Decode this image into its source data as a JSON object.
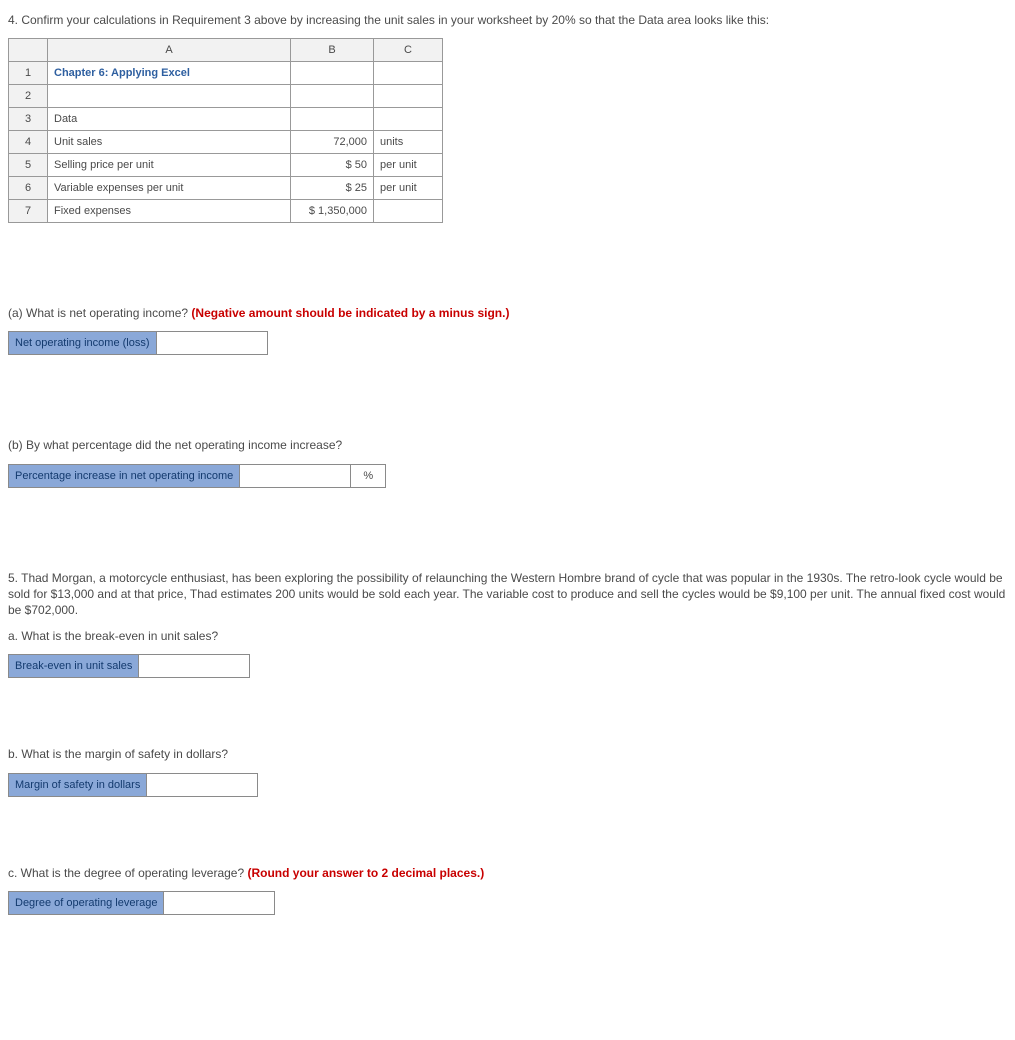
{
  "q4": {
    "text": "4. Confirm your calculations in Requirement 3 above by increasing the unit sales in your worksheet by 20% so that the Data area looks like this:"
  },
  "excel": {
    "headers": {
      "corner": "",
      "A": "A",
      "B": "B",
      "C": "C"
    },
    "rows": [
      {
        "n": "1",
        "A": "Chapter 6: Applying Excel",
        "B": "",
        "C": "",
        "blueA": true
      },
      {
        "n": "2",
        "A": "",
        "B": "",
        "C": ""
      },
      {
        "n": "3",
        "A": "Data",
        "B": "",
        "C": ""
      },
      {
        "n": "4",
        "A": "Unit sales",
        "B": "72,000",
        "C": "units"
      },
      {
        "n": "5",
        "A": "Selling price per unit",
        "B": "$        50",
        "C": "per unit"
      },
      {
        "n": "6",
        "A": "Variable expenses per unit",
        "B": "$        25",
        "C": "per unit"
      },
      {
        "n": "7",
        "A": "Fixed expenses",
        "B": "$ 1,350,000",
        "C": ""
      }
    ]
  },
  "qa": {
    "text": "(a) What is net operating income? ",
    "hint": "(Negative amount should be indicated by a minus sign.)",
    "label": "Net operating income (loss)"
  },
  "qb": {
    "text": "(b) By what percentage did the net operating income increase?",
    "label": "Percentage increase in net operating income",
    "unit": "%"
  },
  "q5": {
    "text": "5. Thad Morgan, a motorcycle enthusiast, has been exploring the possibility of relaunching the Western Hombre brand of cycle that was popular in the 1930s. The retro-look cycle would be sold for $13,000 and at that price, Thad estimates 200 units would be sold each year. The variable cost to produce and sell the cycles would be $9,100 per unit. The annual fixed cost would be $702,000."
  },
  "q5a": {
    "text": "a. What is the break-even in unit sales?",
    "label": "Break-even in unit sales"
  },
  "q5b": {
    "text": "b. What is the margin of safety in dollars?",
    "label": "Margin of safety in dollars"
  },
  "q5c": {
    "text": "c. What is the degree of operating leverage? ",
    "hint": "(Round your answer to 2 decimal places.)",
    "label": "Degree of operating leverage"
  }
}
